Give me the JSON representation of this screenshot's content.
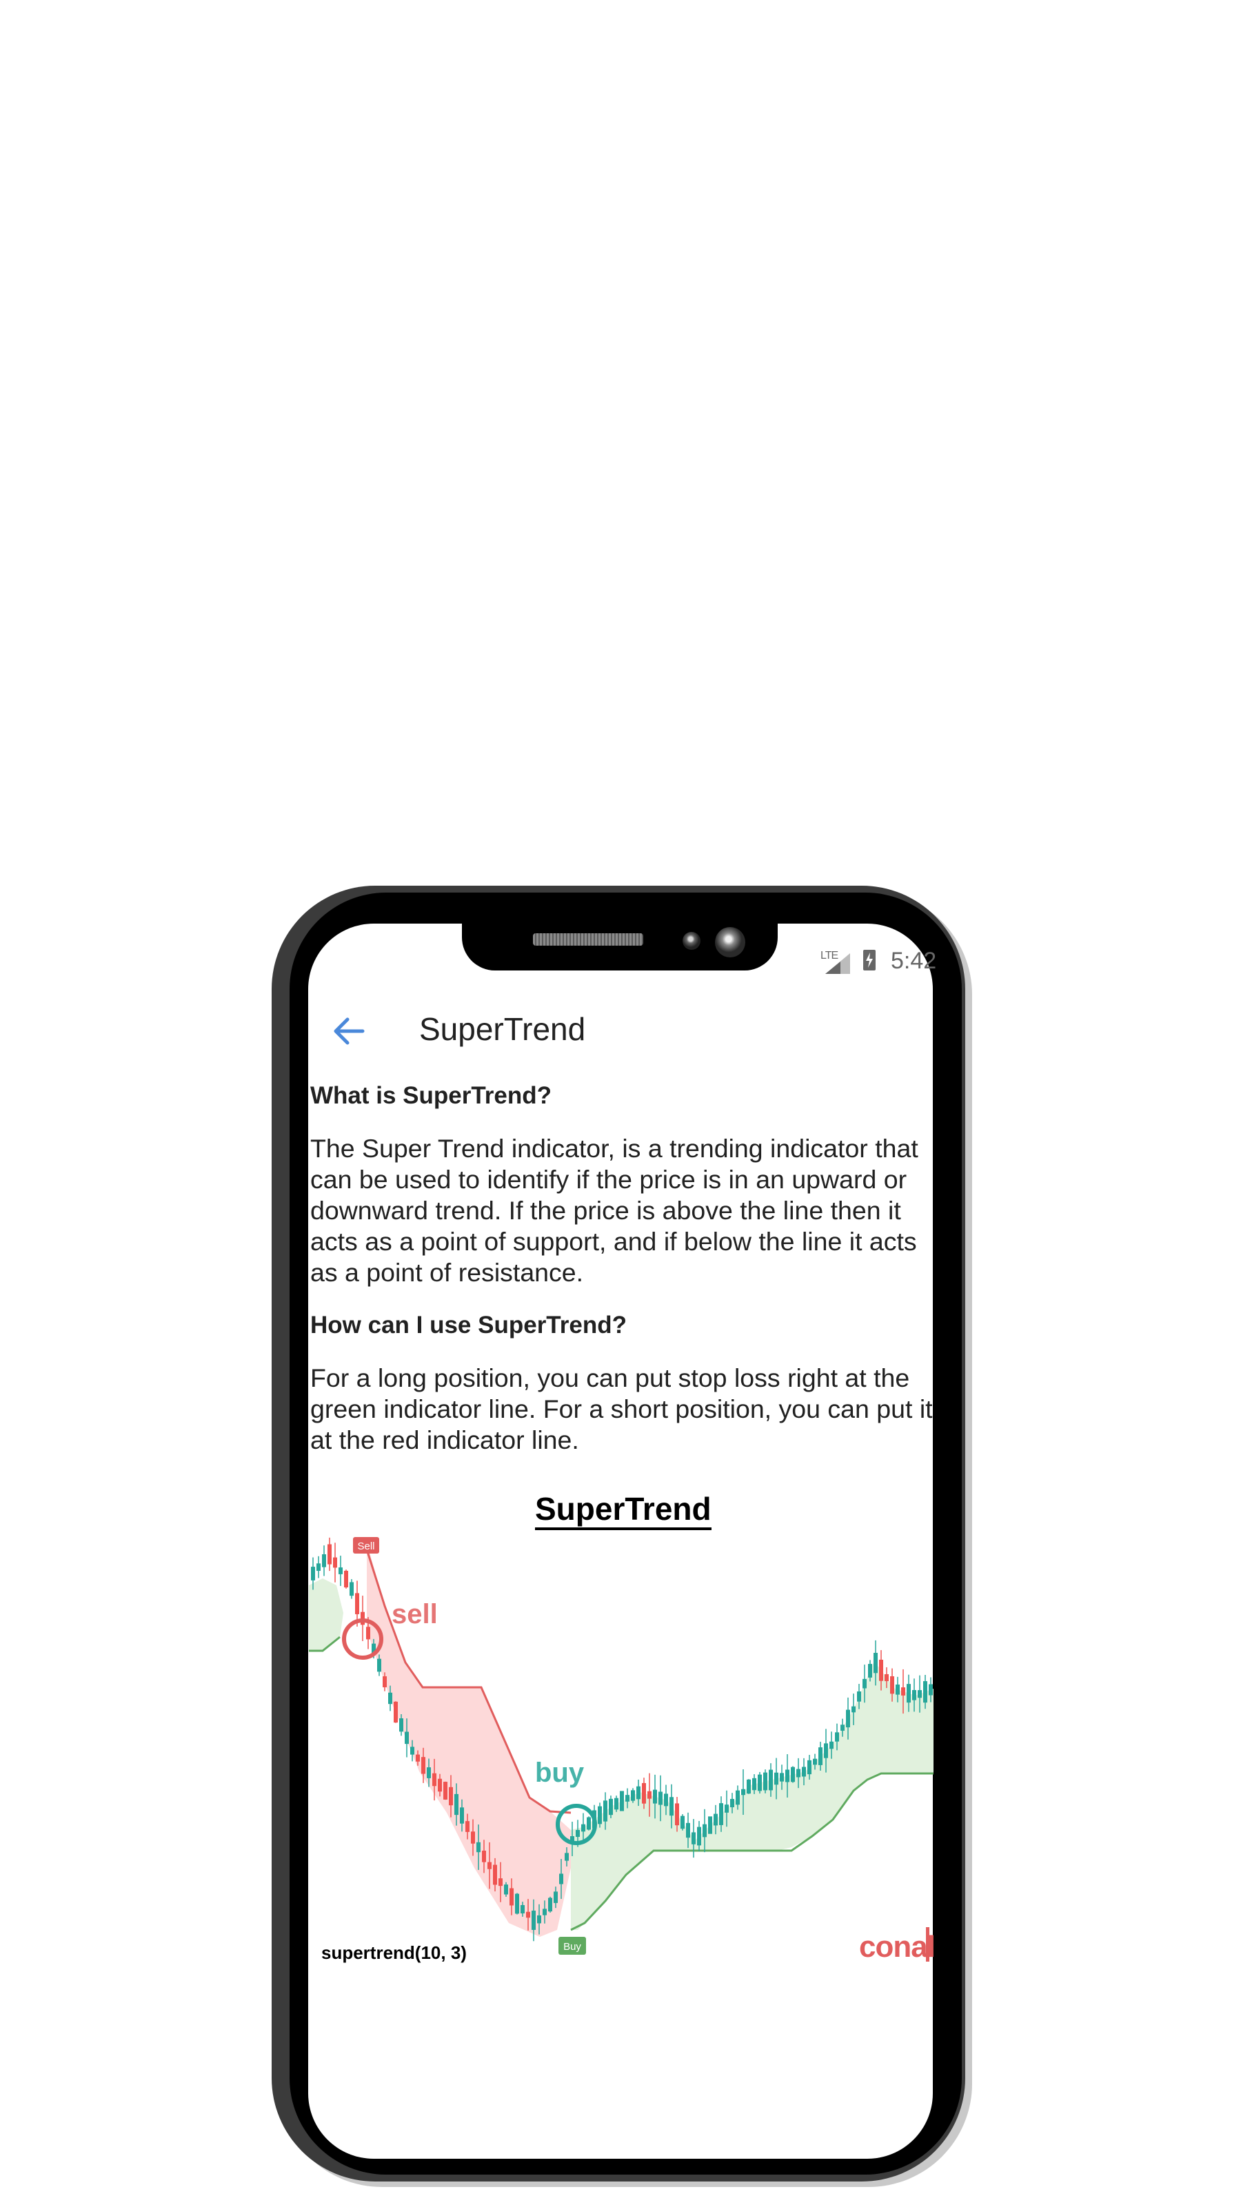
{
  "status_bar": {
    "network": "LTE",
    "time": "5:42"
  },
  "app_bar": {
    "title": "SuperTrend",
    "back_icon": "arrow-left-icon",
    "accent_color": "#4a88da"
  },
  "sections": [
    {
      "heading": "What is SuperTrend?",
      "body": "The Super Trend indicator, is a trending indicator that can be used to identify if the price is in an upward or downward trend. If the price is above the line then it acts as a point of support, and if below the line it acts as a point of resistance."
    },
    {
      "heading": "How can I use SuperTrend?",
      "body": "For a long position, you can put stop loss right at the green indicator line. For a short position, you can put it at the red indicator line."
    }
  ],
  "figure": {
    "title": "SuperTrend",
    "caption": "supertrend(10, 3)",
    "logo": "conal",
    "sell_annotation": "sell",
    "buy_annotation": "buy",
    "sell_tag": "Sell",
    "buy_tag": "Buy",
    "colors": {
      "up": "#26a69a",
      "down": "#ef5350",
      "up_fill": "#e1f1dd",
      "down_fill": "#fdd9d9",
      "up_line": "#5faa5f",
      "down_line": "#e15d5d"
    }
  }
}
